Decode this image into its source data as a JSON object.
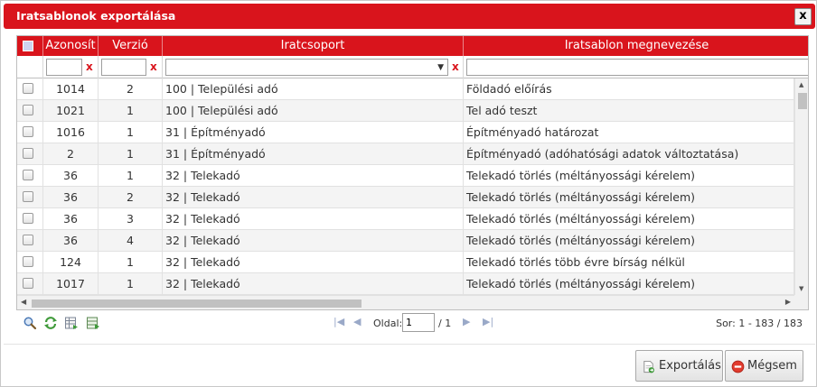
{
  "dialog": {
    "title": "Iratsablonok exportálása",
    "close_label": "x"
  },
  "columns": {
    "id": "Azonosít",
    "version": "Verzió",
    "group": "Iratcsoport",
    "name": "Iratsablon megnevezése"
  },
  "filters": {
    "clear_glyph": "x",
    "select_arrow": "▼"
  },
  "rows": [
    {
      "id": "1014",
      "version": "2",
      "group": "100 | Települési adó",
      "name": "Földadó előírás"
    },
    {
      "id": "1021",
      "version": "1",
      "group": "100 | Települési adó",
      "name": "Tel adó teszt"
    },
    {
      "id": "1016",
      "version": "1",
      "group": "31 | Építményadó",
      "name": "Építményadó határozat"
    },
    {
      "id": "2",
      "version": "1",
      "group": "31 | Építményadó",
      "name": "Építményadó (adóhatósági adatok változtatása)"
    },
    {
      "id": "36",
      "version": "1",
      "group": "32 | Telekadó",
      "name": "Telekadó törlés (méltányossági kérelem)"
    },
    {
      "id": "36",
      "version": "2",
      "group": "32 | Telekadó",
      "name": "Telekadó törlés (méltányossági kérelem)"
    },
    {
      "id": "36",
      "version": "3",
      "group": "32 | Telekadó",
      "name": "Telekadó törlés (méltányossági kérelem)"
    },
    {
      "id": "36",
      "version": "4",
      "group": "32 | Telekadó",
      "name": "Telekadó törlés (méltányossági kérelem)"
    },
    {
      "id": "124",
      "version": "1",
      "group": "32 | Telekadó",
      "name": "Telekadó törlés több évre bírság nélkül"
    },
    {
      "id": "1017",
      "version": "1",
      "group": "32 | Telekadó",
      "name": "Telekadó törlés (méltányossági kérelem)"
    }
  ],
  "pager": {
    "page_label": "Oldal:",
    "page_value": "1",
    "page_total": "/ 1",
    "status": "Sor: 1 - 183 / 183"
  },
  "buttons": {
    "export": "Exportálás",
    "cancel": "Mégsem"
  },
  "colors": {
    "accent": "#d9141c",
    "header_text": "#ffffff"
  },
  "icons": [
    "search-icon",
    "refresh-icon",
    "export-grid-icon",
    "export-excel-icon",
    "first-page-icon",
    "prev-page-icon",
    "next-page-icon",
    "last-page-icon",
    "export-doc-icon",
    "cancel-circle-icon"
  ]
}
